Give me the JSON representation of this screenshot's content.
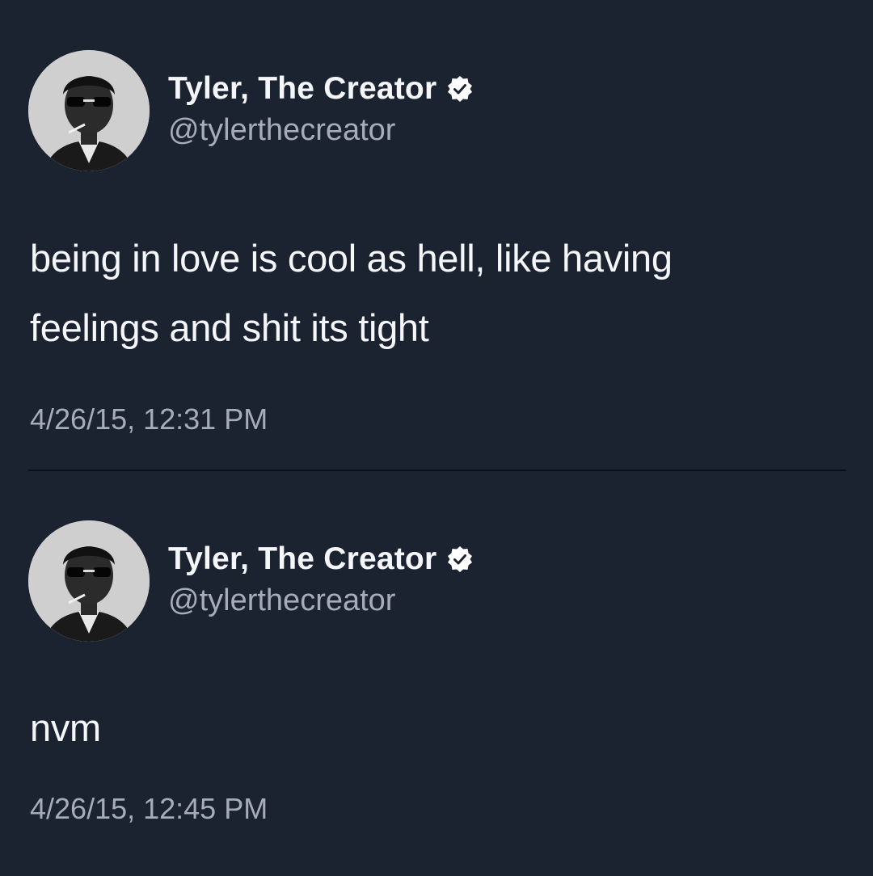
{
  "tweets": [
    {
      "author": {
        "display_name": "Tyler, The Creator",
        "handle": "@tylerthecreator",
        "verified": true,
        "avatar_icon": "profile-photo"
      },
      "text_line_1": "being in love is cool as hell, like having",
      "text_line_2": "feelings and shit its tight",
      "timestamp": "4/26/15, 12:31 PM"
    },
    {
      "author": {
        "display_name": "Tyler, The Creator",
        "handle": "@tylerthecreator",
        "verified": true,
        "avatar_icon": "profile-photo"
      },
      "text_line_1": "nvm",
      "timestamp": "4/26/15, 12:45 PM"
    }
  ],
  "colors": {
    "background": "#1b2230",
    "primary_text": "#f4f6f9",
    "secondary_text": "#a6adb8",
    "verified_badge": "#ffffff"
  }
}
